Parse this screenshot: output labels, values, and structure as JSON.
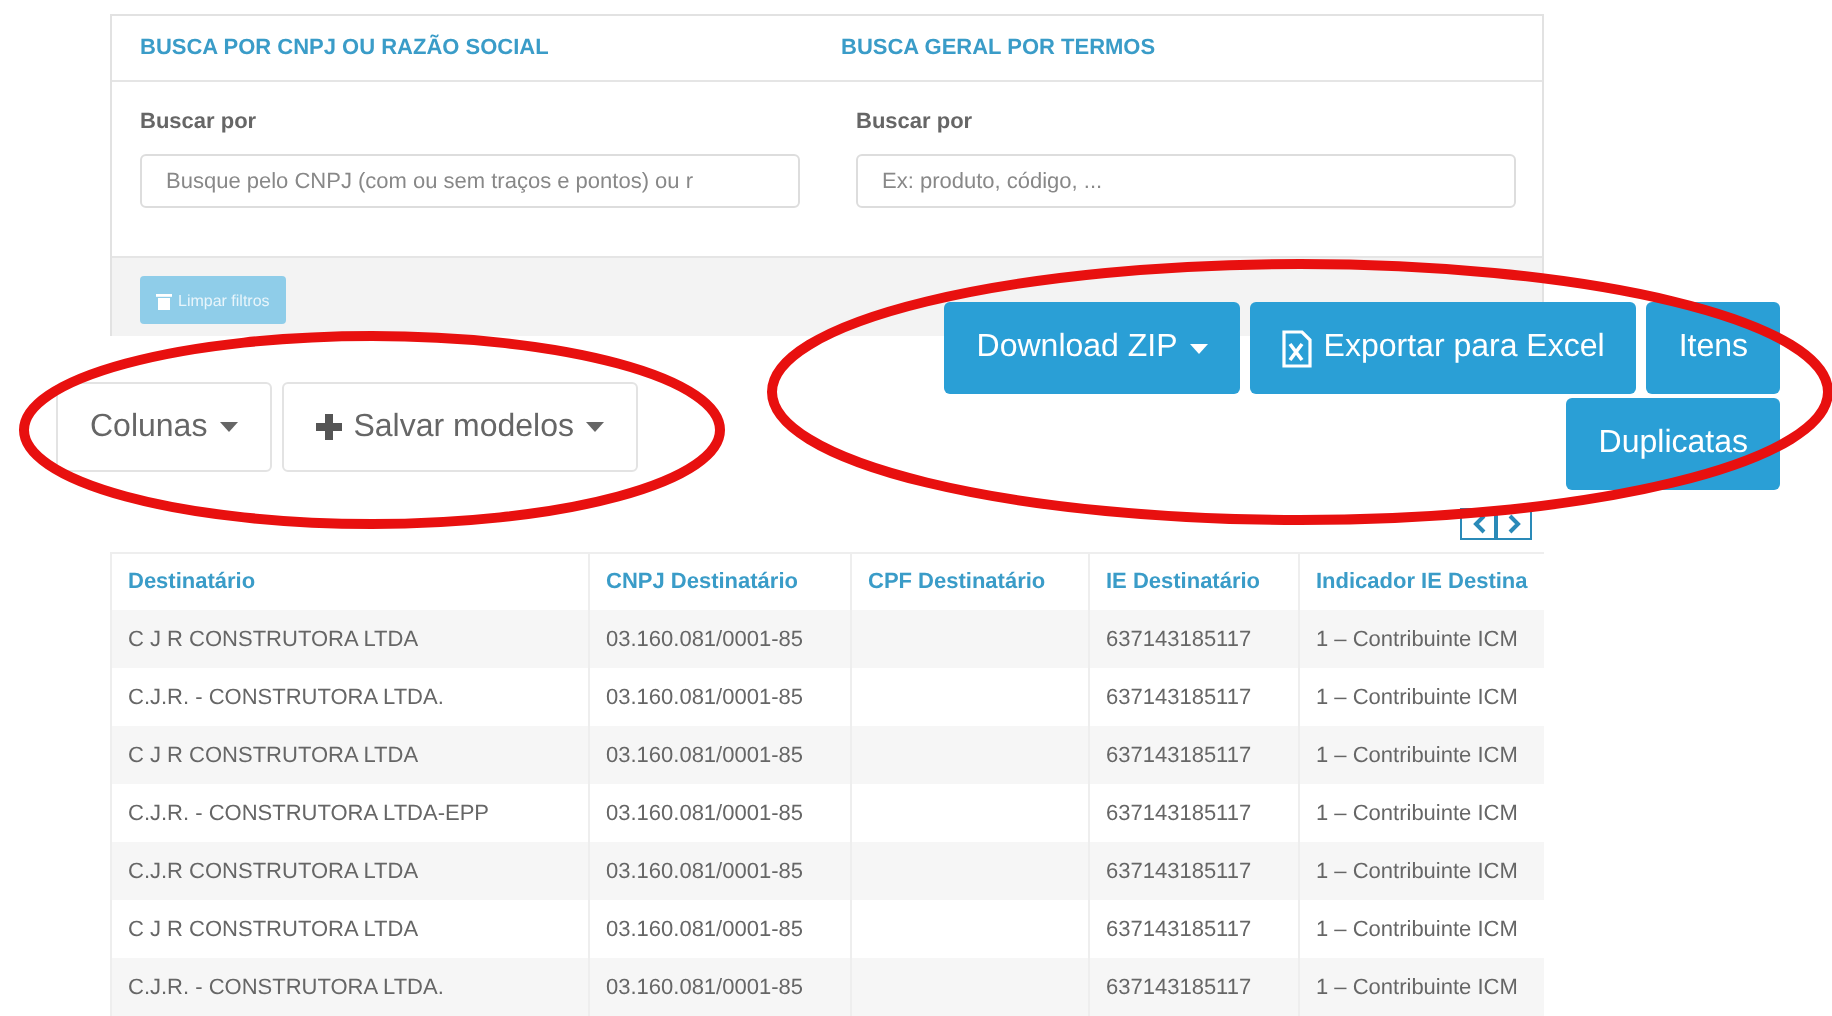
{
  "search_panel": {
    "sections": [
      {
        "title": "BUSCA POR CNPJ OU RAZÃO SOCIAL",
        "label": "Buscar por",
        "placeholder": "Busque pelo CNPJ (com ou sem traços e pontos) ou r"
      },
      {
        "title": "BUSCA GERAL POR TERMOS",
        "label": "Buscar por",
        "placeholder": "Ex: produto, código, ..."
      }
    ],
    "clear_button": {
      "label": "Limpar filtros",
      "disabled": true
    }
  },
  "toolbar_left": [
    {
      "kind": "dropdown",
      "label": "Colunas"
    },
    {
      "kind": "plus-dropdown",
      "label": "Salvar modelos"
    }
  ],
  "toolbar_right": [
    {
      "kind": "dropdown",
      "label": "Download ZIP"
    },
    {
      "kind": "excel",
      "label": "Exportar para Excel"
    },
    {
      "kind": "plain",
      "label": "Itens"
    },
    {
      "kind": "plain",
      "label": "Duplicatas"
    }
  ],
  "table": {
    "columns": [
      "Destinatário",
      "CNPJ Destinatário",
      "CPF Destinatário",
      "IE Destinatário",
      "Indicador IE Destina"
    ],
    "rows": [
      [
        "C J R CONSTRUTORA LTDA",
        "03.160.081/0001-85",
        "",
        "637143185117",
        "1 – Contribuinte ICM"
      ],
      [
        "C.J.R. - CONSTRUTORA LTDA.",
        "03.160.081/0001-85",
        "",
        "637143185117",
        "1 – Contribuinte ICM"
      ],
      [
        "C J R CONSTRUTORA LTDA",
        "03.160.081/0001-85",
        "",
        "637143185117",
        "1 – Contribuinte ICM"
      ],
      [
        "C.J.R. - CONSTRUTORA LTDA-EPP",
        "03.160.081/0001-85",
        "",
        "637143185117",
        "1 – Contribuinte ICM"
      ],
      [
        "C.J.R CONSTRUTORA LTDA",
        "03.160.081/0001-85",
        "",
        "637143185117",
        "1 – Contribuinte ICM"
      ],
      [
        "C J R CONSTRUTORA LTDA",
        "03.160.081/0001-85",
        "",
        "637143185117",
        "1 – Contribuinte ICM"
      ],
      [
        "C.J.R. - CONSTRUTORA LTDA.",
        "03.160.081/0001-85",
        "",
        "637143185117",
        "1 – Contribuinte ICM"
      ]
    ]
  }
}
